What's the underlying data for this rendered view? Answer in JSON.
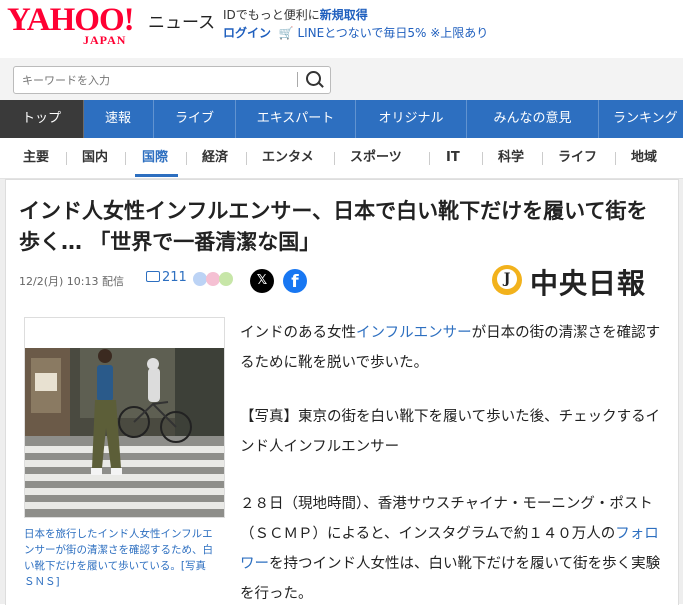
{
  "header": {
    "logo_text": "YAHOO!",
    "logo_sub": "JAPAN",
    "service_name": "ニュース",
    "promo_text": "IDでもっと便利に",
    "promo_link": "新規取得",
    "login_label": "ログイン",
    "line_promo": "LINEとつないで毎日5% ※上限あり"
  },
  "search": {
    "placeholder": "キーワードを入力"
  },
  "nav": {
    "tabs": [
      "トップ",
      "速報",
      "ライブ",
      "エキスパート",
      "オリジナル",
      "みんなの意見",
      "ランキング"
    ],
    "active": "トップ"
  },
  "subnav": {
    "items": [
      "主要",
      "国内",
      "国際",
      "経済",
      "エンタメ",
      "スポーツ",
      "IT",
      "科学",
      "ライフ",
      "地域"
    ],
    "active": "国際"
  },
  "article": {
    "title": "インド人女性インフルエンサー、日本で白い靴下だけを履いて街を歩く… 「世界で一番清潔な国」",
    "date": "12/2(月) 10:13 配信",
    "comment_count": "211",
    "publisher": "中央日報",
    "publisher_mark": "J",
    "share_x": "𝕏",
    "share_fb": "f",
    "photo_caption": "日本を旅行したインド人女性インフルエンサーが街の清潔さを確認するため、白い靴下だけを履いて歩いている。[写真　ＳＮＳ]",
    "para1_a": "インドのある女性",
    "para1_link": "インフルエンサー",
    "para1_b": "が日本の街の清潔さを確認するために靴を脱いで歩いた。",
    "photo_link": "【写真】東京の街を白い靴下を履いて歩いた後、チェックするインド人インフルエンサー",
    "para2_a": "２８日（現地時間）、香港サウスチャイナ・モーニング・ポスト（ＳＣＭＰ）によると、インスタグラムで約１４０万人の",
    "para2_link": "フォロワー",
    "para2_b": "を持つインド人女性は、白い靴下だけを履いて街を歩く実験を行った。"
  },
  "colors": {
    "brand_red": "#ff0033",
    "nav_blue": "#2d6fc0",
    "active_tab": "#3a3a3a",
    "link": "#2d6fc0"
  }
}
